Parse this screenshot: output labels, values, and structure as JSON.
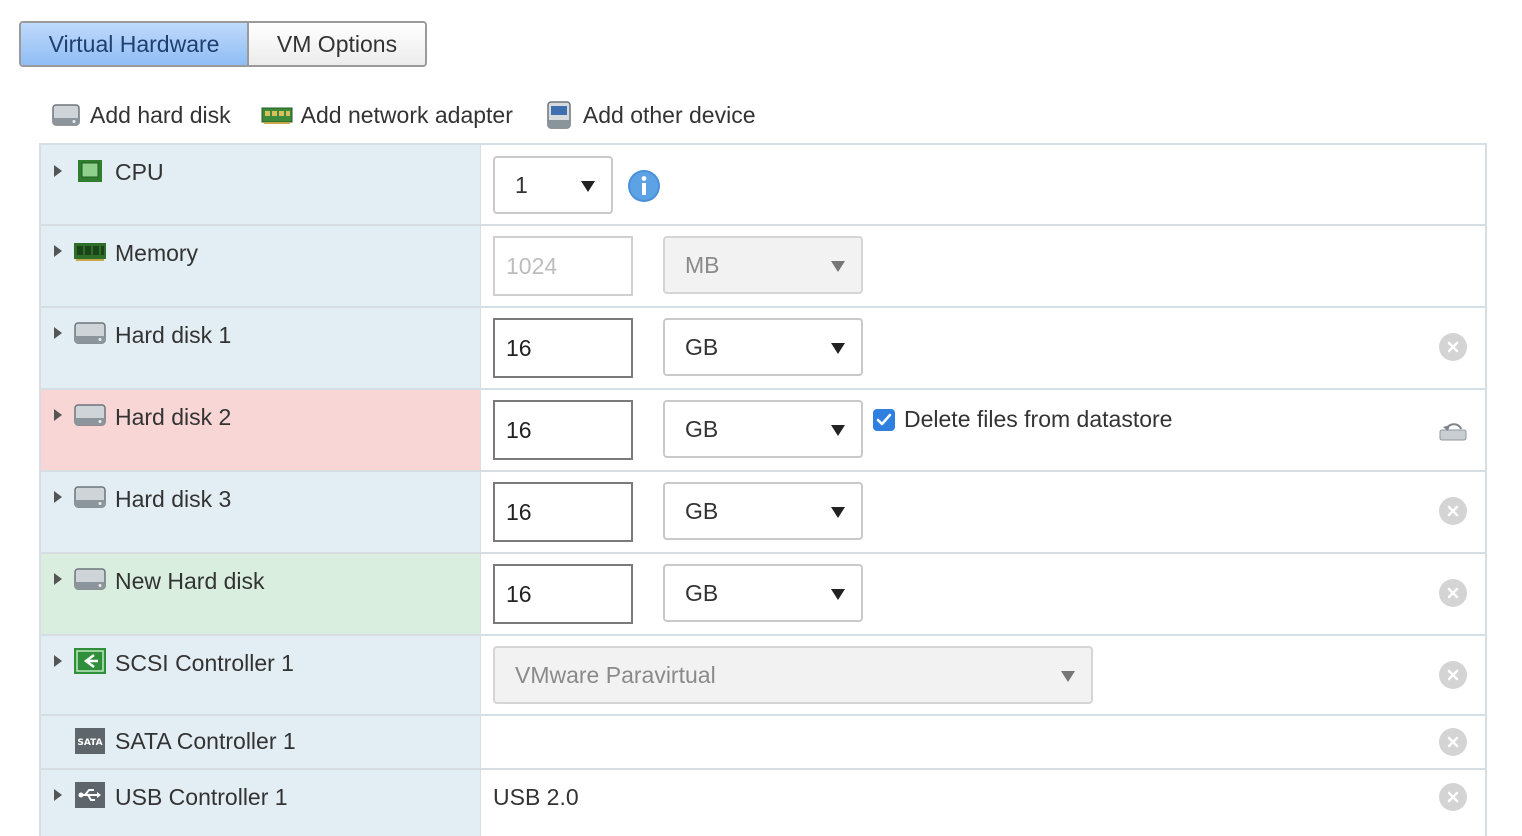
{
  "tabs": [
    {
      "label": "Virtual Hardware",
      "active": true
    },
    {
      "label": "VM Options",
      "active": false
    }
  ],
  "toolbar": {
    "add_hard_disk": {
      "label": "Add hard disk",
      "icon": "hard-disk-icon"
    },
    "add_network_adapter": {
      "label": "Add network adapter",
      "icon": "network-card-icon"
    },
    "add_other_device": {
      "label": "Add other device",
      "icon": "device-icon"
    }
  },
  "devices": {
    "cpu": {
      "label": "CPU",
      "icon": "cpu-chip-icon",
      "value": "1"
    },
    "memory": {
      "label": "Memory",
      "icon": "memory-module-icon",
      "value": "1024",
      "unit": "MB"
    },
    "hard_disk_1": {
      "label": "Hard disk 1",
      "icon": "hard-disk-icon",
      "size": "16",
      "unit": "GB"
    },
    "hard_disk_2": {
      "label": "Hard disk 2",
      "icon": "hard-disk-icon",
      "size": "16",
      "unit": "GB",
      "state": "removed",
      "delete_files_label": "Delete files from datastore",
      "delete_files_checked": true
    },
    "hard_disk_3": {
      "label": "Hard disk 3",
      "icon": "hard-disk-icon",
      "size": "16",
      "unit": "GB"
    },
    "new_hard_disk": {
      "label": "New Hard disk",
      "icon": "hard-disk-icon",
      "size": "16",
      "unit": "GB",
      "state": "added"
    },
    "scsi_controller_1": {
      "label": "SCSI Controller 1",
      "icon": "scsi-controller-icon",
      "type": "VMware Paravirtual"
    },
    "sata_controller_1": {
      "label": "SATA Controller 1",
      "icon": "sata-controller-icon",
      "icon_text": "SATA"
    },
    "usb_controller_1": {
      "label": "USB Controller 1",
      "icon": "usb-icon",
      "value": "USB 2.0"
    }
  },
  "colors": {
    "label_bg": "#e3edf4",
    "removed_bg": "#f8d6d6",
    "added_bg": "#d9eedf",
    "tab_active": "#a8ccf8",
    "checkbox_blue": "#2f7fe0",
    "info_blue": "#4a90d9"
  }
}
